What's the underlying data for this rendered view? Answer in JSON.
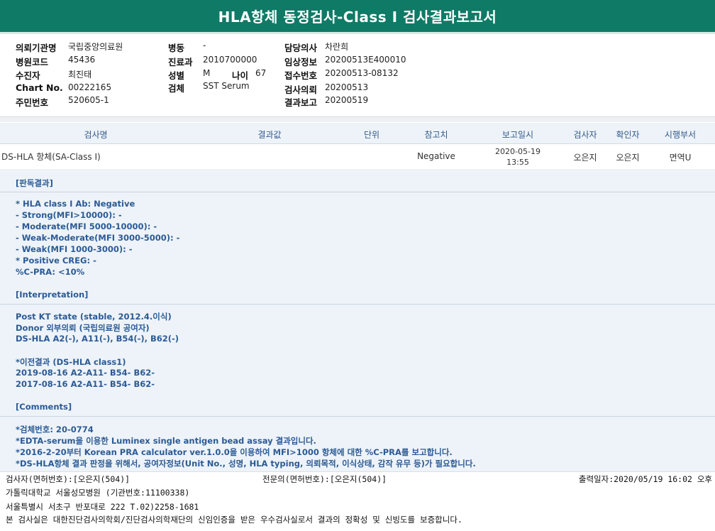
{
  "report_title": "HLA항체 동정검사-Class I 검사결과보고서",
  "patient": {
    "institution_label": "의뢰기관명",
    "institution": "국립중앙의료원",
    "hospital_code_label": "병원코드",
    "hospital_code": "45436",
    "recipient_label": "수진자",
    "recipient": "최진태",
    "chart_label": "Chart No.",
    "chart_no": "00222165",
    "resident_label": "주민번호",
    "resident_no": "520605-1",
    "ward_label": "병동",
    "ward": "-",
    "dept_label": "진료과",
    "dept": "2010700000",
    "sex_label": "성별",
    "sex": "M",
    "age_label": "나이",
    "age": "67",
    "specimen_label": "검체",
    "specimen": "SST Serum",
    "doctor_label": "담당의사",
    "doctor": "차란희",
    "clinical_label": "임상정보",
    "clinical": "20200513E400010",
    "accession_label": "접수번호",
    "accession": "20200513-08132",
    "request_label": "검사의뢰",
    "request_date": "20200513",
    "report_label": "결과보고",
    "report_date": "20200519"
  },
  "table": {
    "headers": [
      "검사명",
      "결과값",
      "단위",
      "참고치",
      "보고일시",
      "검사자",
      "확인자",
      "시행부서"
    ],
    "row": {
      "test_name": "DS-HLA 항체(SA-Class I)",
      "result": "",
      "unit": "",
      "reference": "Negative",
      "report_date": "2020-05-19",
      "report_time": "13:55",
      "examiner": "오은지",
      "confirmer": "오은지",
      "department": "면역U"
    }
  },
  "sections": {
    "judgment_title": "[판독결과]",
    "judgment_lines": [
      "* HLA class I Ab:  Negative",
      "- Strong(MFI>10000): -",
      "- Moderate(MFI 5000-10000): -",
      "- Weak-Moderate(MFI 3000-5000): -",
      "- Weak(MFI 1000-3000): -",
      "* Positive CREG: -",
      " %C-PRA: <10%"
    ],
    "interp_title": "[Interpretation]",
    "interp_lines": [
      "Post KT state (stable, 2012.4.이식)",
      "Donor 외부의뢰 (국립의료원 공여자)",
      "DS-HLA A2(-), A11(-), B54(-), B62(-)",
      "",
      "*이전결과 (DS-HLA class1)",
      "2019-08-16 A2-A11- B54- B62-",
      "2017-08-16 A2-A11- B54- B62-"
    ],
    "comments_title": "[Comments]",
    "comments_lines": [
      "*검체번호: 20-0774",
      "*EDTA-serum을 이용한 Luminex single antigen bead assay 결과입니다.",
      "*2016-2-20부터 Korean PRA calculator ver.1.0.0을 이용하여 MFI>1000 항체에 대한 %C-PRA를 보고합니다.",
      "*DS-HLA항체 결과 판정을 위해서, 공여자정보(Unit No., 성명, HLA typing, 의뢰목적, 이식상태, 감작 유무 등)가 필요합니다."
    ]
  },
  "footer": {
    "examiner": "검사자(면허번호):[오은지(504)]",
    "specialist": "전문의(면허번호):[오은지(504)]",
    "printed": "출력일자:2020/05/19 16:02 오후",
    "hospital": "가톨릭대학교 서울성모병원 (기관번호:11100338)",
    "address": "서울특별시 서초구 반포대로 222 T.02)2258-1681",
    "certification": "본 검사실은 대한진단검사의학회/진단검사의학재단의 신임인증을 받은 우수검사실로서 결과의 정확성 및 신빙도를 보증합니다."
  }
}
